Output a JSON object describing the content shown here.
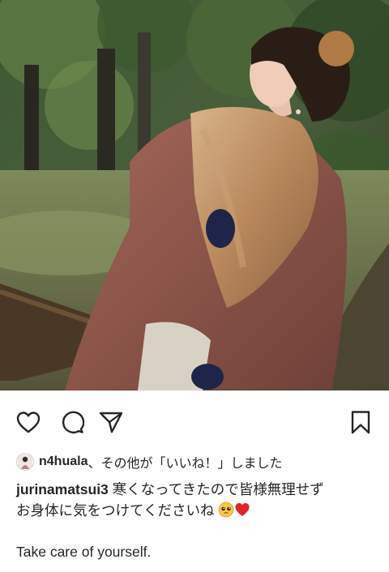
{
  "post": {
    "photo_alt_icon": "post-photo",
    "actions": {
      "like_icon": "heart-outline-icon",
      "comment_icon": "comment-bubble-icon",
      "share_icon": "paper-plane-icon",
      "save_icon": "bookmark-icon"
    },
    "likes": {
      "username": "n4huala",
      "suffix": "、その他が「いいね！」しました"
    },
    "caption": {
      "username": "jurinamatsui3",
      "line1": " 寒くなってきたので皆様無理せず",
      "line2": "お身体に気をつけてくださいね",
      "emojis": [
        "pleading-face-emoji",
        "red-heart-emoji"
      ],
      "line3": "Take care of yourself."
    }
  }
}
